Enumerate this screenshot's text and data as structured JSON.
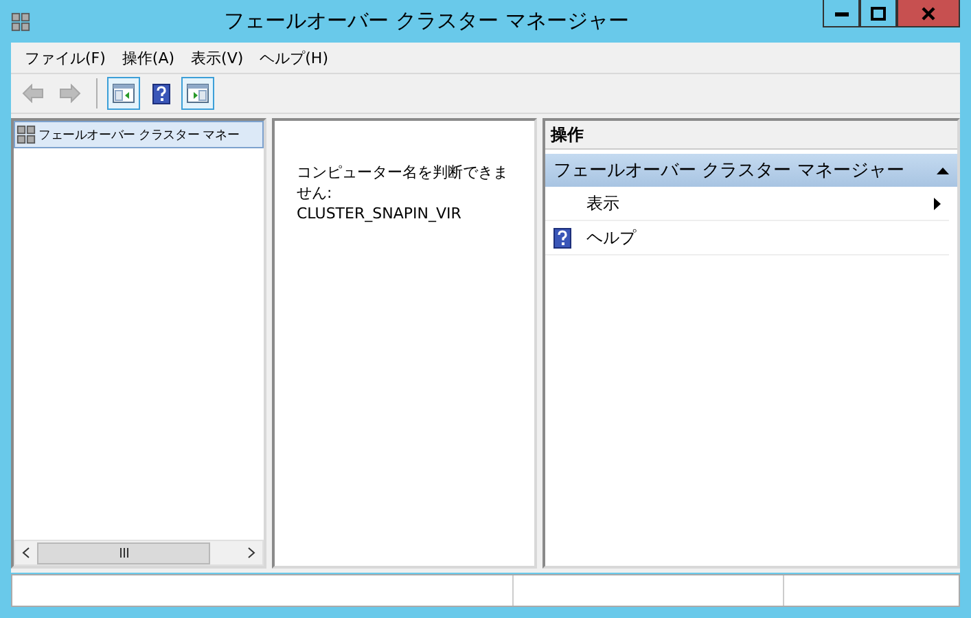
{
  "window": {
    "title": "フェールオーバー クラスター マネージャー"
  },
  "menu": [
    "ファイル(F)",
    "操作(A)",
    "表示(V)",
    "ヘルプ(H)"
  ],
  "toolbar": [
    {
      "kind": "back",
      "disabled": true,
      "selected": false
    },
    {
      "kind": "forward",
      "disabled": true,
      "selected": false
    },
    {
      "kind": "tree-toggle",
      "disabled": false,
      "selected": true
    },
    {
      "kind": "help",
      "disabled": false,
      "selected": false
    },
    {
      "kind": "action-toggle",
      "disabled": false,
      "selected": true
    }
  ],
  "tree": {
    "items": [
      {
        "label": "フェールオーバー クラスター マネー",
        "selected": true
      }
    ]
  },
  "center": {
    "message": "コンピューター名を判断できません:\nCLUSTER_SNAPIN_VIR"
  },
  "actions": {
    "header": "操作",
    "section": {
      "title": "フェールオーバー クラスター マネージャー",
      "expanded": true
    },
    "items": [
      {
        "kind": "submenu",
        "label": "表示"
      },
      {
        "kind": "help",
        "label": "ヘルプ"
      }
    ]
  }
}
